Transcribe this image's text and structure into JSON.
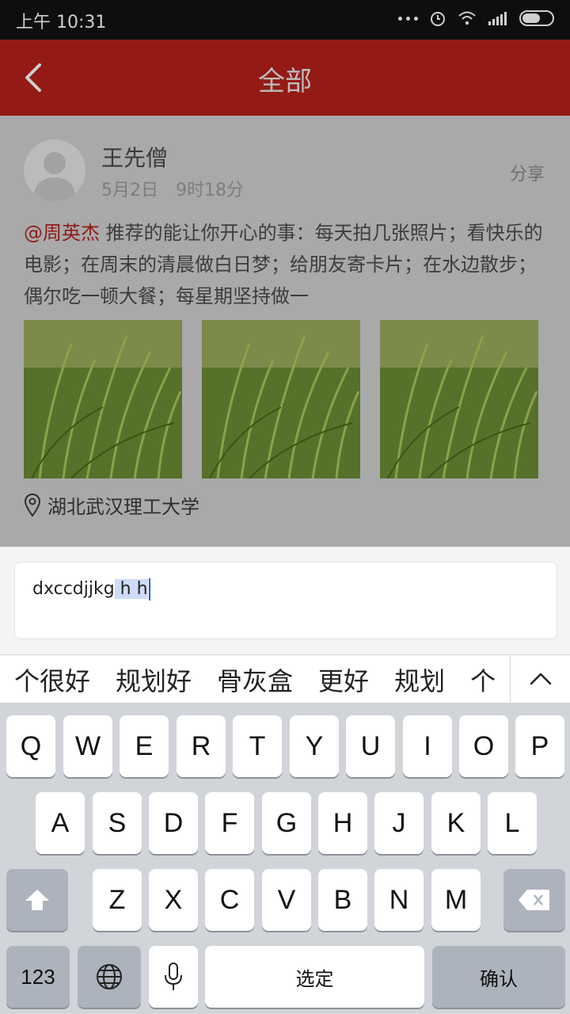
{
  "status_bar": {
    "time": "上午 10:31"
  },
  "header": {
    "title": "全部"
  },
  "post": {
    "author": "王先僧",
    "date": "5月2日",
    "time": "9时18分",
    "share_label": "分享",
    "mention": "@周英杰",
    "text": " 推荐的能让你开心的事：每天拍几张照片；看快乐的电影；在周末的清晨做白日梦；给朋友寄卡片；在水边散步；偶尔吃一顿大餐；每星期坚持做一",
    "location": "湖北武汉理工大学"
  },
  "input": {
    "text_plain": "dxccdjjkg",
    "text_composing": " h h"
  },
  "suggestions": [
    "个很好",
    "规划好",
    "骨灰盒",
    "更好",
    "规划",
    "个"
  ],
  "keyboard": {
    "row1": [
      "Q",
      "W",
      "E",
      "R",
      "T",
      "Y",
      "U",
      "I",
      "O",
      "P"
    ],
    "row2": [
      "A",
      "S",
      "D",
      "F",
      "G",
      "H",
      "J",
      "K",
      "L"
    ],
    "row3": [
      "Z",
      "X",
      "C",
      "V",
      "B",
      "N",
      "M"
    ],
    "numbers_label": "123",
    "space_label": "选定",
    "confirm_label": "确认"
  },
  "icons": {
    "back": "chevron-left-icon",
    "location": "location-pin-icon",
    "shift": "shift-icon",
    "delete": "backspace-icon",
    "globe": "globe-icon",
    "mic": "microphone-icon",
    "collapse": "chevron-up-icon"
  },
  "colors": {
    "header": "#941b15",
    "mention": "#8f1b16",
    "caret": "#1f5bd6"
  }
}
